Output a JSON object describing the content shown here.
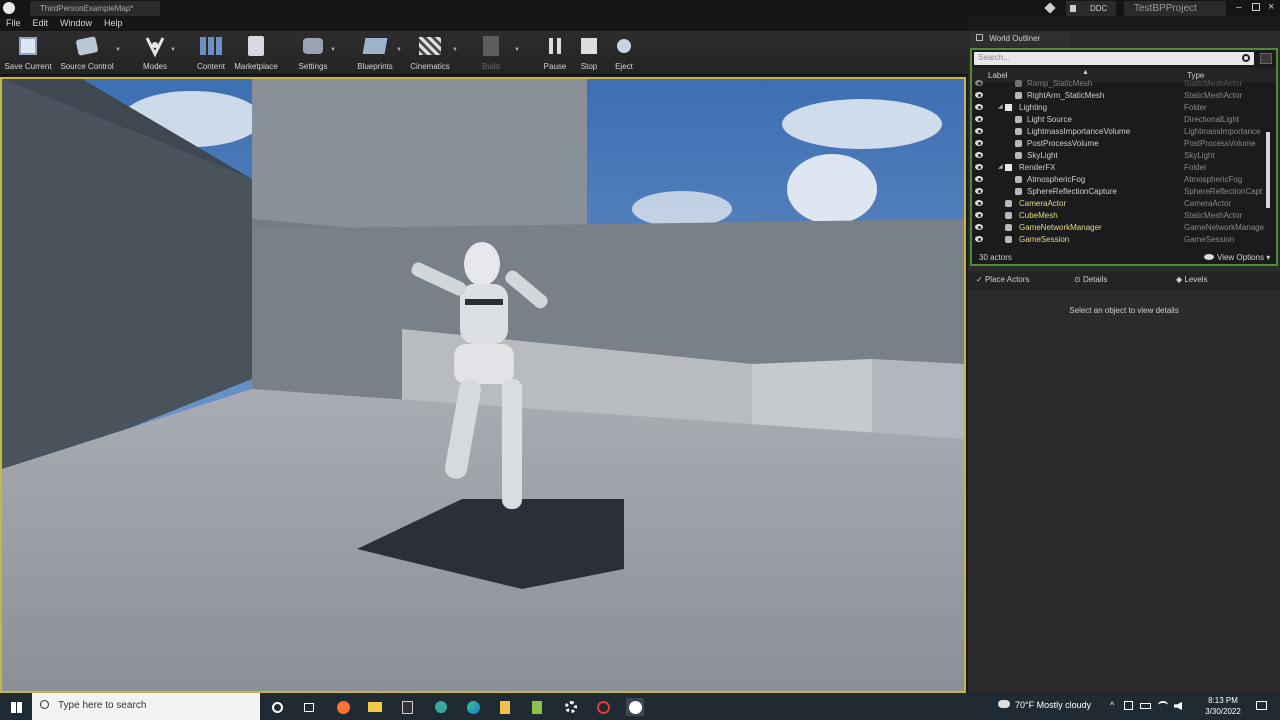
{
  "titlebar": {
    "doc_tab": "ThirdPersonExampleMap*",
    "ddc_label": "DDC",
    "project_name": "TestBPProject"
  },
  "menu": [
    "File",
    "Edit",
    "Window",
    "Help"
  ],
  "toolbar": {
    "save_current": "Save Current",
    "source_control": "Source Control",
    "modes": "Modes",
    "content": "Content",
    "marketplace": "Marketplace",
    "settings": "Settings",
    "blueprints": "Blueprints",
    "cinematics": "Cinematics",
    "build": "Build",
    "pause": "Pause",
    "stop": "Stop",
    "eject": "Eject"
  },
  "outliner": {
    "tab": "World Outliner",
    "search_placeholder": "Search...",
    "col_label": "Label",
    "col_type": "Type",
    "rows": [
      {
        "label": "Ramp_StaticMesh",
        "type": "StaticMeshActor"
      },
      {
        "label": "RightArm_StaticMesh",
        "type": "StaticMeshActor"
      },
      {
        "label": "Lighting",
        "type": "Folder"
      },
      {
        "label": "Light Source",
        "type": "DirectionalLight"
      },
      {
        "label": "LightmassImportanceVolume",
        "type": "LightmassImportance"
      },
      {
        "label": "PostProcessVolume",
        "type": "PostProcessVolume"
      },
      {
        "label": "SkyLight",
        "type": "SkyLight"
      },
      {
        "label": "RenderFX",
        "type": "Folder"
      },
      {
        "label": "AtmosphericFog",
        "type": "AtmosphericFog"
      },
      {
        "label": "SphereReflectionCapture",
        "type": "SphereReflectionCapt"
      },
      {
        "label": "CameraActor",
        "type": "CameraActor"
      },
      {
        "label": "CubeMesh",
        "type": "StaticMeshActor"
      },
      {
        "label": "GameNetworkManager",
        "type": "GameNetworkManage"
      },
      {
        "label": "GameSession",
        "type": "GameSession"
      }
    ],
    "actor_count": "30 actors",
    "view_options": "View Options"
  },
  "detail_tabs": {
    "place_actors": "Place Actors",
    "details": "Details",
    "levels": "Levels"
  },
  "details": {
    "empty_message": "Select an object to view details"
  },
  "taskbar": {
    "search_placeholder": "Type here to search",
    "weather": "70°F  Mostly cloudy",
    "time": "8:13 PM",
    "date": "3/30/2022"
  },
  "colors": {
    "viewport_border": "#c8b44a",
    "outliner_border": "#4e8a3a",
    "highlight_label": "#e8d98a"
  }
}
